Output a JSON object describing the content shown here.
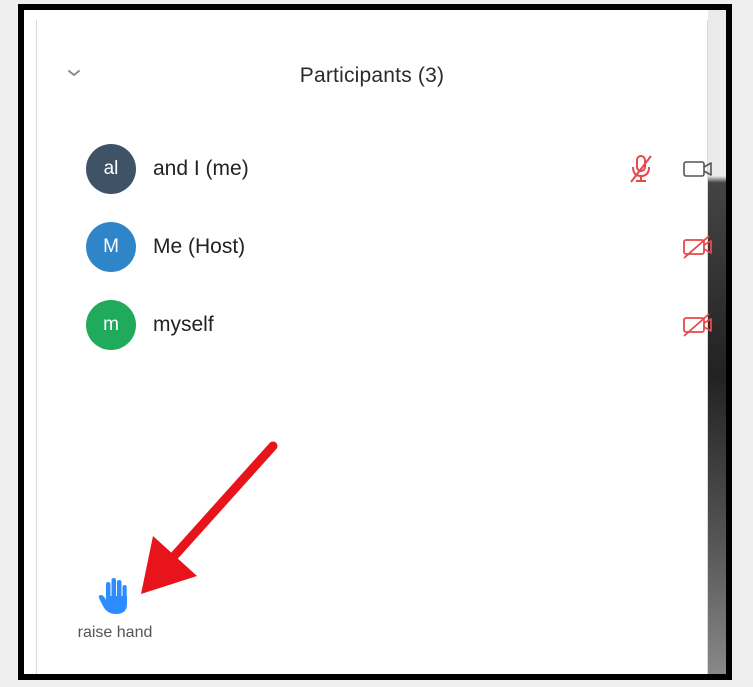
{
  "header": {
    "title": "Participants (3)"
  },
  "participants": [
    {
      "initials": "al",
      "name": "and I (me)",
      "avatar_color": "#3f5366",
      "mic": "muted",
      "camera": "on"
    },
    {
      "initials": "M",
      "name": "Me (Host)",
      "avatar_color": "#2e86c9",
      "mic": "none",
      "camera": "off"
    },
    {
      "initials": "m",
      "name": "myself",
      "avatar_color": "#1fab5b",
      "mic": "none",
      "camera": "off"
    }
  ],
  "footer": {
    "raise_hand_label": "raise hand"
  },
  "colors": {
    "muted_red": "#e8484a",
    "hand_blue": "#2d8cff",
    "arrow_red": "#e8141b"
  }
}
